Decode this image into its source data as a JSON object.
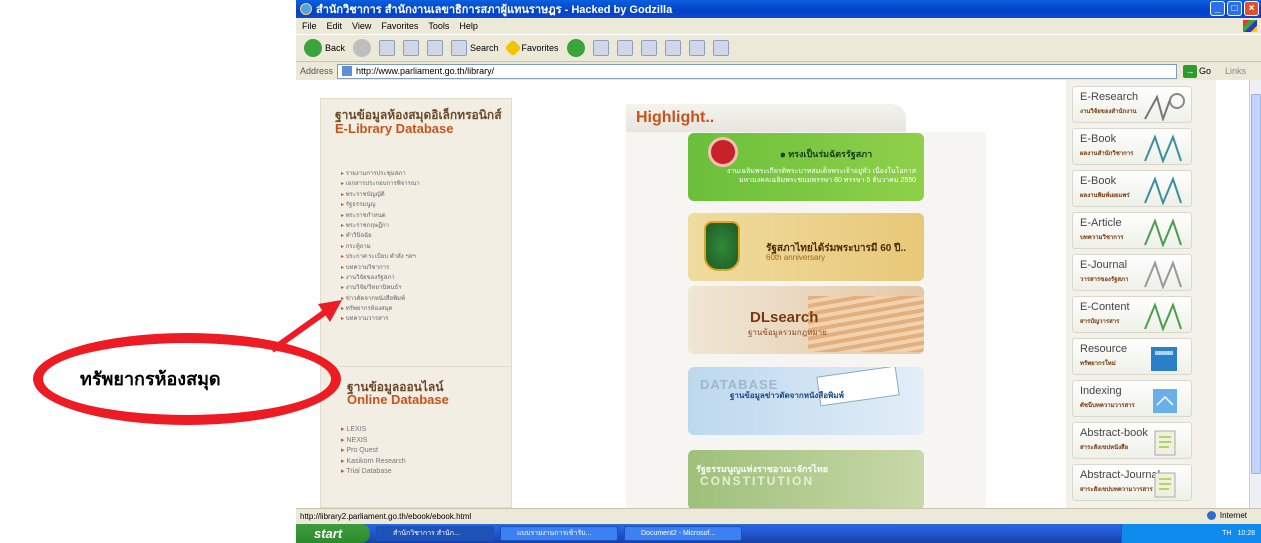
{
  "browser": {
    "title": "สำนักวิชาการ สำนักงานเลขาธิการสภาผู้แทนราษฎร - Hacked by Godzilla",
    "menu": [
      "File",
      "Edit",
      "View",
      "Favorites",
      "Tools",
      "Help"
    ],
    "toolbar": {
      "back": "Back",
      "search": "Search",
      "favorites": "Favorites"
    },
    "address_label": "Address",
    "address": "http://www.parliament.go.th/library/",
    "go": "Go",
    "links": "Links"
  },
  "left_panel": {
    "title_th": "ฐานข้อมูลห้องสมุดอิเล็กทรอนิกส์",
    "title_en": "E-Library Database",
    "items": [
      "รายงานการประชุมสภา",
      "เอกสารประกอบการพิจารณา",
      "พระราชบัญญัติ",
      "รัฐธรรมนูญ",
      "พระราชกำหนด",
      "พระราชกฤษฎีกา",
      "คำวินิจฉัย",
      "กระทู้ถาม",
      "ประกาศ ระเบียบ คำสั่ง ฯลฯ",
      "บทความวิชาการ",
      "งานวิจัยของรัฐสภา",
      "งานวิจัย/วิทยานิพนธ์ฯ",
      "ข่าวตัดจากหนังสือพิมพ์",
      "ทรัพยากรห้องสมุด",
      "บทความวารสาร"
    ]
  },
  "online_panel": {
    "title_th": "ฐานข้อมูลออนไลน์",
    "title_en": "Online Database",
    "items": [
      "LEXIS",
      "NEXIS",
      "Pro Quest",
      "Kasikorn Research",
      "Trial Database"
    ]
  },
  "highlight": {
    "title": "Highlight..",
    "card1_title": "๑ ทรงเป็นร่มฉัตรรัฐสภา",
    "card1_sub": "งานเฉลิมพระเกียรติพระบาทสมเด็จพระเจ้าอยู่หัว เนื่องในโอกาสมหามงคลเฉลิมพระชนมพรรษา 80 พรรษา 5 ธันวาคม 2550",
    "card2_title": "รัฐสภาไทยได้ร่มพระบารมี 60 ปี..",
    "card2_sub": "60th anniversary",
    "card3_title": "DLsearch",
    "card3_sub": "ฐานข้อมูลรวมกฎหมาย",
    "card4_title": "DATABASE",
    "card4_sub": "ฐานข้อมูลข่าวตัดจากหนังสือพิมพ์",
    "card5_title": "รัฐธรรมนูญแห่งราชอาณาจักรไทย",
    "card5_sub": "CONSTITUTION"
  },
  "right_tiles": [
    {
      "title": "E-Research",
      "sub": "งานวิจัยของสำนักงาน"
    },
    {
      "title": "E-Book",
      "sub": "ผลงานสำนักวิชาการ"
    },
    {
      "title": "E-Book",
      "sub": "ผลงานพิมพ์เผยแพร่"
    },
    {
      "title": "E-Article",
      "sub": "บทความวิชาการ"
    },
    {
      "title": "E-Journal",
      "sub": "วารสารของรัฐสภา"
    },
    {
      "title": "E-Content",
      "sub": "สารบัญวารสาร"
    },
    {
      "title": "Resource",
      "sub": "ทรัพยากรใหม่"
    },
    {
      "title": "Indexing",
      "sub": "ดัชนีบทความวารสาร"
    },
    {
      "title": "Abstract-book",
      "sub": "สาระสังเขปหนังสือ"
    },
    {
      "title": "Abstract-Journal",
      "sub": "สาระสังเขปบทความวารสาร"
    }
  ],
  "status": {
    "url": "http://library2.parliament.go.th/ebook/ebook.html",
    "zone": "Internet"
  },
  "taskbar": {
    "start": "start",
    "tasks": [
      "สำนักวิชาการ สำนัก...",
      "แบบรายงานการเข้ารับ...",
      "Document2 - Microsof..."
    ],
    "tray": "TH",
    "time": "10:28"
  },
  "annotation": {
    "label": "ทรัพยากรห้องสมุด"
  },
  "colors": {
    "accent": "#C8531A",
    "callout": "#ED1C24",
    "xp_blue": "#0A5FE0"
  }
}
